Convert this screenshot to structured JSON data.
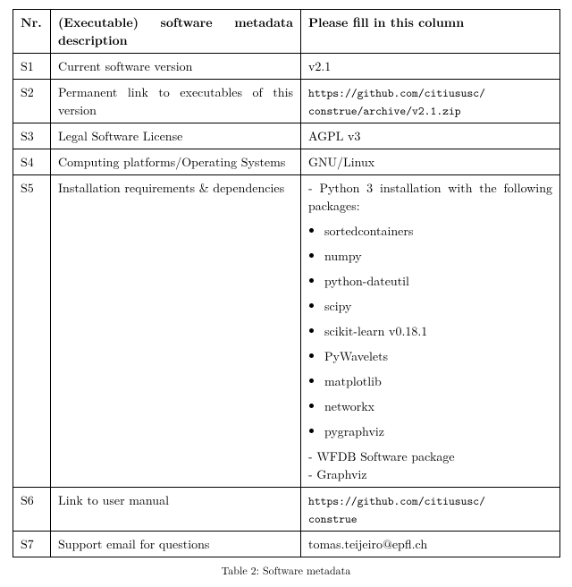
{
  "headers": {
    "nr": "Nr.",
    "desc": "(Executable) software metadata description",
    "val": "Please fill in this column"
  },
  "rows": {
    "s1": {
      "nr": "S1",
      "desc": "Current software version",
      "val": "v2.1"
    },
    "s2": {
      "nr": "S2",
      "desc": "Permanent link to executables of this version",
      "link_a": "https://github.com/citiususc/",
      "link_b": "construe/archive/v2.1.zip"
    },
    "s3": {
      "nr": "S3",
      "desc": "Legal Software License",
      "val": "AGPL v3"
    },
    "s4": {
      "nr": "S4",
      "desc": "Computing platforms/Operating Systems",
      "val": "GNU/Linux"
    },
    "s5": {
      "nr": "S5",
      "desc": "Installation requirements & dependencies",
      "intro": "- Python 3 installation with the following packages:",
      "packages": {
        "p0": "sortedcontainers",
        "p1": "numpy",
        "p2": "python-dateutil",
        "p3": "scipy",
        "p4": "scikit-learn v0.18.1",
        "p5": "PyWavelets",
        "p6": "matplotlib",
        "p7": "networkx",
        "p8": "pygraphviz"
      },
      "extra1": "- WFDB Software package",
      "extra2": "- Graphviz"
    },
    "s6": {
      "nr": "S6",
      "desc": "Link to user manual",
      "link_a": "https://github.com/citiususc/",
      "link_b": "construe"
    },
    "s7": {
      "nr": "S7",
      "desc": "Support email for questions",
      "val": "tomas.teijeiro@epfl.ch"
    }
  },
  "caption": "Table 2: Software metadata"
}
